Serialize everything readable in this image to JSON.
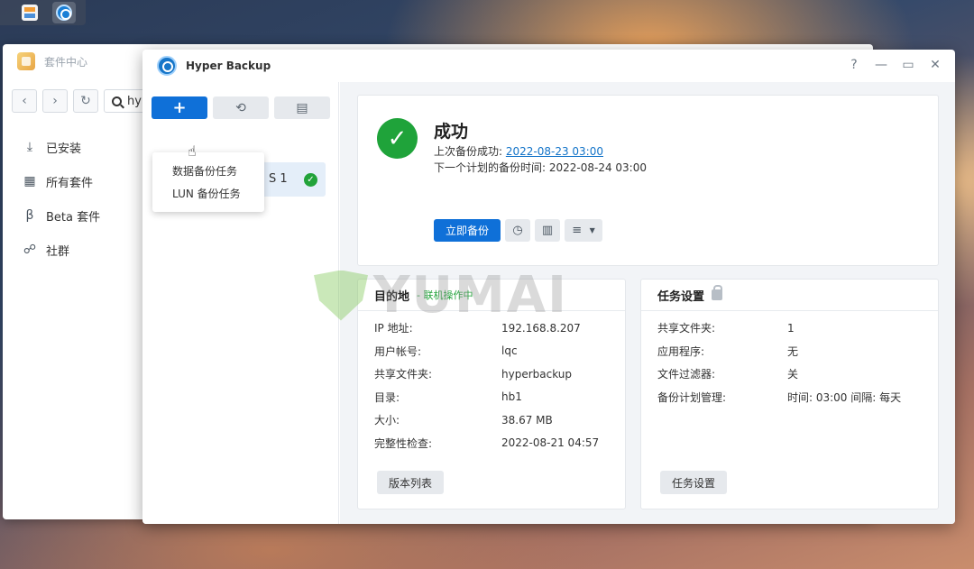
{
  "taskbar": {
    "apps": [
      "package-center",
      "hyper-backup"
    ]
  },
  "package_center": {
    "title": "套件中心",
    "search": {
      "value": "hyp"
    },
    "sidebar": [
      {
        "icon": "download-icon",
        "label": "已安装"
      },
      {
        "icon": "grid-icon",
        "label": "所有套件"
      },
      {
        "icon": "beta-icon",
        "label": "Beta 套件"
      },
      {
        "icon": "community-icon",
        "label": "社群"
      }
    ]
  },
  "hyper_backup": {
    "title": "Hyper Backup",
    "window_controls": {
      "help": "?",
      "minimize": "—",
      "maximize": "▭",
      "close": "✕"
    },
    "toolbar": {
      "add": "+",
      "restore": "⟲",
      "log": "▤"
    },
    "dropdown": [
      "数据备份任务",
      "LUN 备份任务"
    ],
    "task_item": {
      "name": "S 1"
    },
    "status": {
      "title": "成功",
      "last_label": "上次备份成功: ",
      "last_value": "2022-08-23 03:00",
      "next_label": "下一个计划的备份时间: ",
      "next_value": "2022-08-24 03:00",
      "backup_now": "立即备份"
    },
    "destination": {
      "title": "目的地",
      "subtitle": "- 联机操作中",
      "rows": [
        {
          "label": "IP 地址:",
          "value": "192.168.8.207"
        },
        {
          "label": "用户帐号:",
          "value": "lqc"
        },
        {
          "label": "共享文件夹:",
          "value": "hyperbackup"
        },
        {
          "label": "目录:",
          "value": "hb1"
        },
        {
          "label": "大小:",
          "value": "38.67 MB"
        },
        {
          "label": "完整性检查:",
          "value": "2022-08-21 04:57"
        }
      ],
      "button": "版本列表"
    },
    "task_settings": {
      "title": "任务设置",
      "rows": [
        {
          "label": "共享文件夹:",
          "value": "1"
        },
        {
          "label": "应用程序:",
          "value": "无"
        },
        {
          "label": "文件过滤器:",
          "value": "关"
        },
        {
          "label": "备份计划管理:",
          "value": "时间: 03:00 间隔: 每天"
        }
      ],
      "button": "任务设置"
    }
  },
  "watermark": "YUMAI"
}
